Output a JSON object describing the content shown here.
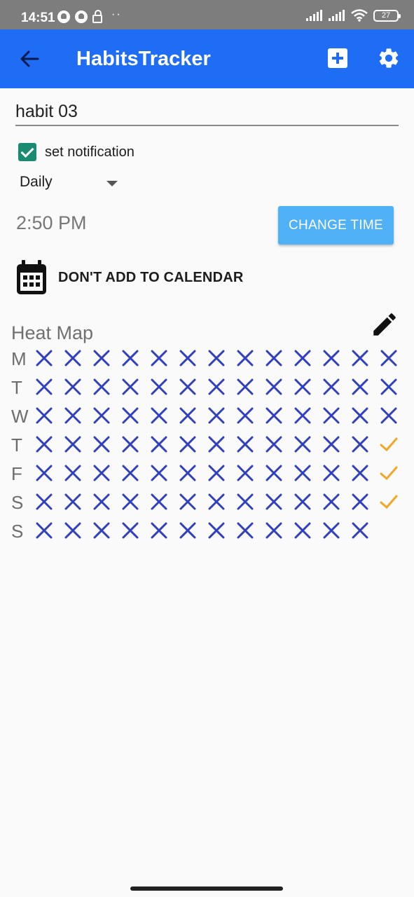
{
  "status_bar": {
    "time": "14:51",
    "battery": "27"
  },
  "app_bar": {
    "title": "HabitsTracker",
    "color": "#1f6df5"
  },
  "form": {
    "habit_name": "habit 03",
    "notification": {
      "label": "set notification",
      "checked": true
    },
    "frequency": {
      "selected": "Daily"
    },
    "time": "2:50 PM",
    "change_time_label": "CHANGE TIME",
    "calendar_label": "DON'T ADD TO CALENDAR"
  },
  "heatmap": {
    "title": "Heat Map",
    "colors": {
      "missed": "#2f3fbd",
      "done": "#f2a724"
    },
    "rows": [
      {
        "day": "M",
        "cells": [
          "x",
          "x",
          "x",
          "x",
          "x",
          "x",
          "x",
          "x",
          "x",
          "x",
          "x",
          "x",
          "x"
        ]
      },
      {
        "day": "T",
        "cells": [
          "x",
          "x",
          "x",
          "x",
          "x",
          "x",
          "x",
          "x",
          "x",
          "x",
          "x",
          "x",
          "x"
        ]
      },
      {
        "day": "W",
        "cells": [
          "x",
          "x",
          "x",
          "x",
          "x",
          "x",
          "x",
          "x",
          "x",
          "x",
          "x",
          "x",
          "x"
        ]
      },
      {
        "day": "T",
        "cells": [
          "x",
          "x",
          "x",
          "x",
          "x",
          "x",
          "x",
          "x",
          "x",
          "x",
          "x",
          "x",
          "check"
        ]
      },
      {
        "day": "F",
        "cells": [
          "x",
          "x",
          "x",
          "x",
          "x",
          "x",
          "x",
          "x",
          "x",
          "x",
          "x",
          "x",
          "check"
        ]
      },
      {
        "day": "S",
        "cells": [
          "x",
          "x",
          "x",
          "x",
          "x",
          "x",
          "x",
          "x",
          "x",
          "x",
          "x",
          "x",
          "check"
        ]
      },
      {
        "day": "S",
        "cells": [
          "x",
          "x",
          "x",
          "x",
          "x",
          "x",
          "x",
          "x",
          "x",
          "x",
          "x",
          "x"
        ]
      }
    ]
  }
}
